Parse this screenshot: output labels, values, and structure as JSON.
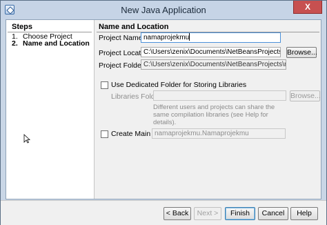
{
  "window": {
    "title": "New Java Application",
    "close_symbol": "X",
    "icon": "netbeans-cube-icon"
  },
  "steps": {
    "heading": "Steps",
    "items": [
      {
        "number": "1.",
        "label": "Choose Project",
        "current": false
      },
      {
        "number": "2.",
        "label": "Name and Location",
        "current": true
      }
    ]
  },
  "form": {
    "heading": "Name and Location",
    "project_name": {
      "label": "Project Name:",
      "value": "namaprojekmu"
    },
    "project_location": {
      "label": "Project Location:",
      "value": "C:\\Users\\zenix\\Documents\\NetBeansProjects",
      "browse_label": "Browse..."
    },
    "project_folder": {
      "label": "Project Folder:",
      "value": "C:\\Users\\zenix\\Documents\\NetBeansProjects\\namaprojekmu"
    },
    "dedicated_folder": {
      "label": "Use Dedicated Folder for Storing Libraries",
      "checked": false
    },
    "libraries_folder": {
      "label": "Libraries Folder:",
      "value": "",
      "browse_label": "Browse..."
    },
    "libraries_help": "Different users and projects can share the same compilation libraries (see Help for details).",
    "main_class": {
      "label": "Create Main Class",
      "checked": false,
      "value": "namaprojekmu.Namaprojekmu"
    }
  },
  "buttons": {
    "back": "< Back",
    "next": "Next >",
    "finish": "Finish",
    "cancel": "Cancel",
    "help": "Help"
  }
}
